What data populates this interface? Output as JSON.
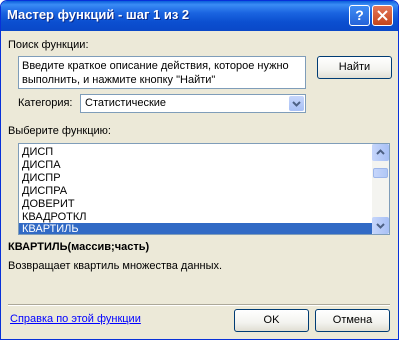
{
  "window": {
    "title": "Мастер функций - шаг 1 из 2",
    "help_label": "?"
  },
  "search": {
    "label": "Поиск функции:",
    "text": "Введите краткое описание действия, которое нужно выполнить, и нажмите кнопку \"Найти\"",
    "find_label": "Найти"
  },
  "category": {
    "label": "Категория:",
    "value": "Статистические"
  },
  "functions": {
    "label": "Выберите функцию:",
    "items": [
      "ДИСП",
      "ДИСПА",
      "ДИСПР",
      "ДИСПРА",
      "ДОВЕРИТ",
      "КВАДРОТКЛ",
      "КВАРТИЛЬ"
    ],
    "selected": "КВАРТИЛЬ"
  },
  "details": {
    "signature": "КВАРТИЛЬ(массив;часть)",
    "description": "Возвращает квартиль множества данных."
  },
  "footer": {
    "help_link": "Справка по этой функции",
    "ok_label": "OK",
    "cancel_label": "Отмена"
  },
  "colors": {
    "titlebar": "#0a5fdb",
    "selection": "#316ac5",
    "link": "#0000ff"
  }
}
